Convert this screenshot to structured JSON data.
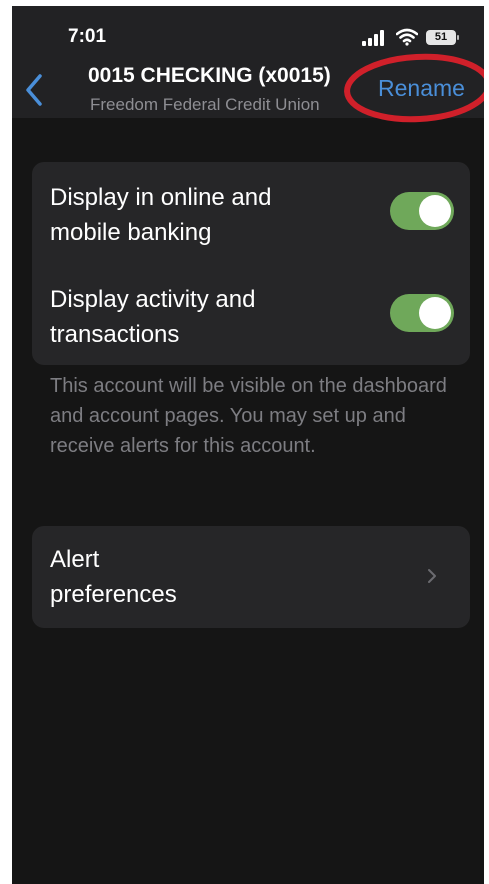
{
  "status_bar": {
    "time": "7:01",
    "battery_level": "51",
    "icons": [
      "signal-icon",
      "wifi-icon",
      "battery-icon"
    ]
  },
  "nav": {
    "back_icon": "chevron-left-icon",
    "title": "0015 CHECKING (x0015)",
    "subtitle": "Freedom Federal Credit Union",
    "rename_label": "Rename",
    "accent_color": "#4a8fd9",
    "annotation_color": "#d0202a"
  },
  "settings": {
    "rows": [
      {
        "label_line1": "Display in online and",
        "label_line2": "mobile banking",
        "enabled": true
      },
      {
        "label_line1": "Display activity and",
        "label_line2": "transactions",
        "enabled": true
      }
    ],
    "toggle_on_color": "#6fa85a",
    "footer": "This account will be visible on the dashboard and account pages. You may set up and receive alerts for this account."
  },
  "alerts": {
    "label_line1": "Alert",
    "label_line2": "preferences",
    "chevron_icon": "chevron-right-icon"
  }
}
